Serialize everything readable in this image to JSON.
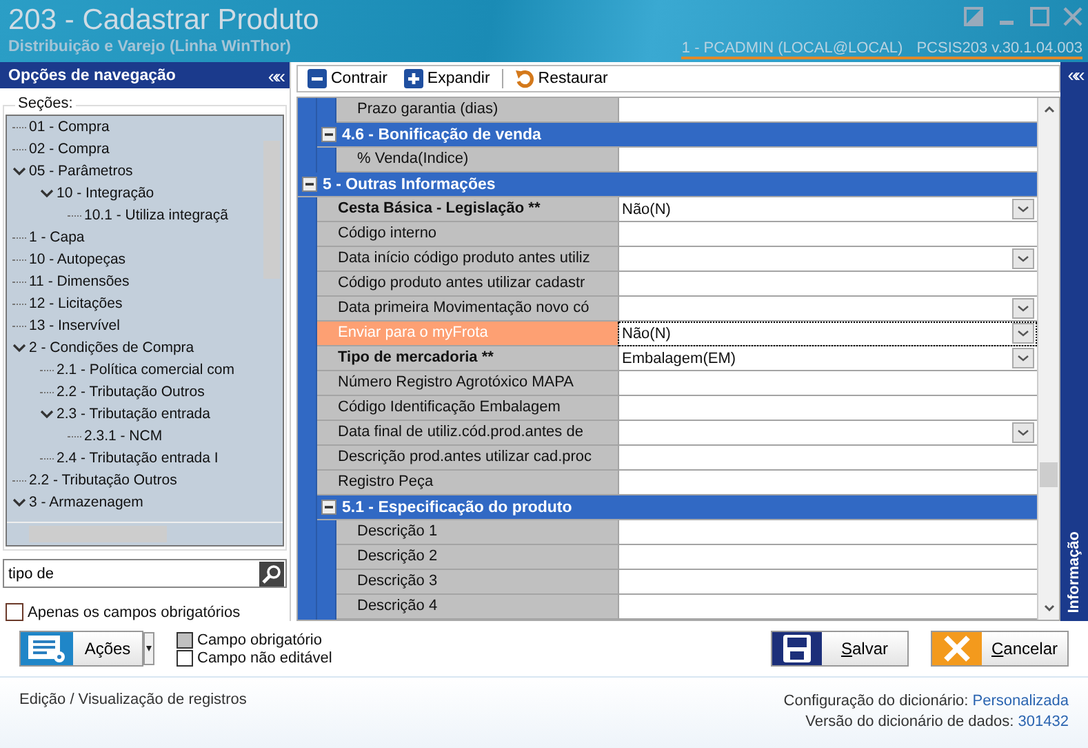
{
  "window": {
    "title": "203 - Cadastrar  Produto",
    "subtitle": "Distribuição e Varejo (Linha WinThor)",
    "user": "1 - PCADMIN (LOCAL@LOCAL)",
    "version": "PCSIS203  v.30.1.04.003"
  },
  "navigation": {
    "title": "Opções de navegação",
    "collapse": "«",
    "sections_label": "Seções:",
    "tree": [
      {
        "label": "01 - Compra"
      },
      {
        "label": "02 - Compra"
      },
      {
        "label": "05 - Parâmetros",
        "expanded": true,
        "children": [
          {
            "label": "10 - Integração",
            "expanded": true,
            "children": [
              {
                "label": "10.1 - Utiliza integraçã"
              }
            ]
          }
        ]
      },
      {
        "label": "1 - Capa"
      },
      {
        "label": "10 - Autopeças"
      },
      {
        "label": "11 - Dimensões"
      },
      {
        "label": "12 - Licitações"
      },
      {
        "label": "13 - Inservível"
      },
      {
        "label": "2 - Condições de Compra",
        "expanded": true,
        "children": [
          {
            "label": "2.1 - Política comercial com"
          },
          {
            "label": "2.2 - Tributação Outros"
          },
          {
            "label": "2.3 - Tributação entrada",
            "expanded": true,
            "children": [
              {
                "label": "2.3.1 - NCM"
              }
            ]
          },
          {
            "label": "2.4 - Tributação entrada I"
          }
        ]
      },
      {
        "label": "2.2 - Tributação Outros"
      },
      {
        "label": "3 - Armazenagem",
        "expanded": true
      }
    ],
    "search": {
      "value": "tipo de"
    },
    "required_only": {
      "label": "Apenas os campos obrigatórios",
      "checked": false
    }
  },
  "toolbar": [
    {
      "kind": "collapse",
      "label": "Contrair"
    },
    {
      "kind": "expand",
      "label": "Expandir"
    },
    {
      "kind": "restore",
      "label": "Restaurar"
    }
  ],
  "grid": [
    {
      "kind": "group",
      "children": [
        {
          "kind": "group",
          "children": [
            {
              "kind": "field",
              "label": "Prazo garantia (dias)"
            }
          ]
        },
        {
          "kind": "group",
          "title": "4.6 - Bonificação de venda",
          "expanded": true,
          "children": [
            {
              "kind": "field",
              "label": "% Venda(Indice)"
            }
          ]
        }
      ]
    },
    {
      "kind": "group",
      "title": "5 - Outras Informações",
      "expanded": true,
      "children": [
        {
          "kind": "field",
          "label": "Cesta Básica - Legislação **",
          "required": true,
          "value": "Não(N)",
          "dropdown": true
        },
        {
          "kind": "field",
          "label": "Código interno"
        },
        {
          "kind": "field",
          "label": "Data início código produto antes utiliz",
          "dropdown": true
        },
        {
          "kind": "field",
          "label": "Código produto antes utilizar cadastr"
        },
        {
          "kind": "field",
          "label": "Data primeira Movimentação novo có",
          "dropdown": true
        },
        {
          "kind": "field",
          "label": "Enviar para o myFrota",
          "value": "Não(N)",
          "dropdown": true,
          "highlighted": true,
          "focused": true
        },
        {
          "kind": "field",
          "label": "Tipo de mercadoria **",
          "required": true,
          "value": "Embalagem(EM)",
          "dropdown": true
        },
        {
          "kind": "field",
          "label": "Número Registro Agrotóxico MAPA"
        },
        {
          "kind": "field",
          "label": "Código Identificação Embalagem"
        },
        {
          "kind": "field",
          "label": "Data final de utiliz.cód.prod.antes de",
          "dropdown": true
        },
        {
          "kind": "field",
          "label": "Descrição prod.antes utilizar cad.proc"
        },
        {
          "kind": "field",
          "label": "Registro Peça"
        },
        {
          "kind": "group",
          "title": "5.1 - Especificação do produto",
          "expanded": true,
          "children": [
            {
              "kind": "field",
              "label": "Descrição 1"
            },
            {
              "kind": "field",
              "label": "Descrição 2"
            },
            {
              "kind": "field",
              "label": "Descrição 3"
            },
            {
              "kind": "field",
              "label": "Descrição 4"
            }
          ]
        }
      ]
    }
  ],
  "info_panel": {
    "collapse": "«",
    "label": "Informação"
  },
  "actions": {
    "label": "Ações"
  },
  "legend": [
    {
      "kind": "required",
      "label": "Campo obrigatório"
    },
    {
      "kind": "readonly",
      "label": "Campo não editável"
    }
  ],
  "buttons": [
    {
      "kind": "save",
      "label": "Salvar"
    },
    {
      "kind": "cancel",
      "label": "Cancelar"
    }
  ],
  "status": {
    "mode": "Edição / Visualização de registros",
    "config_label": "Configuração do dicionário:",
    "config_value": "Personalizada",
    "version_label": "Versão do dicionário de dados:",
    "version_value": "301432"
  }
}
